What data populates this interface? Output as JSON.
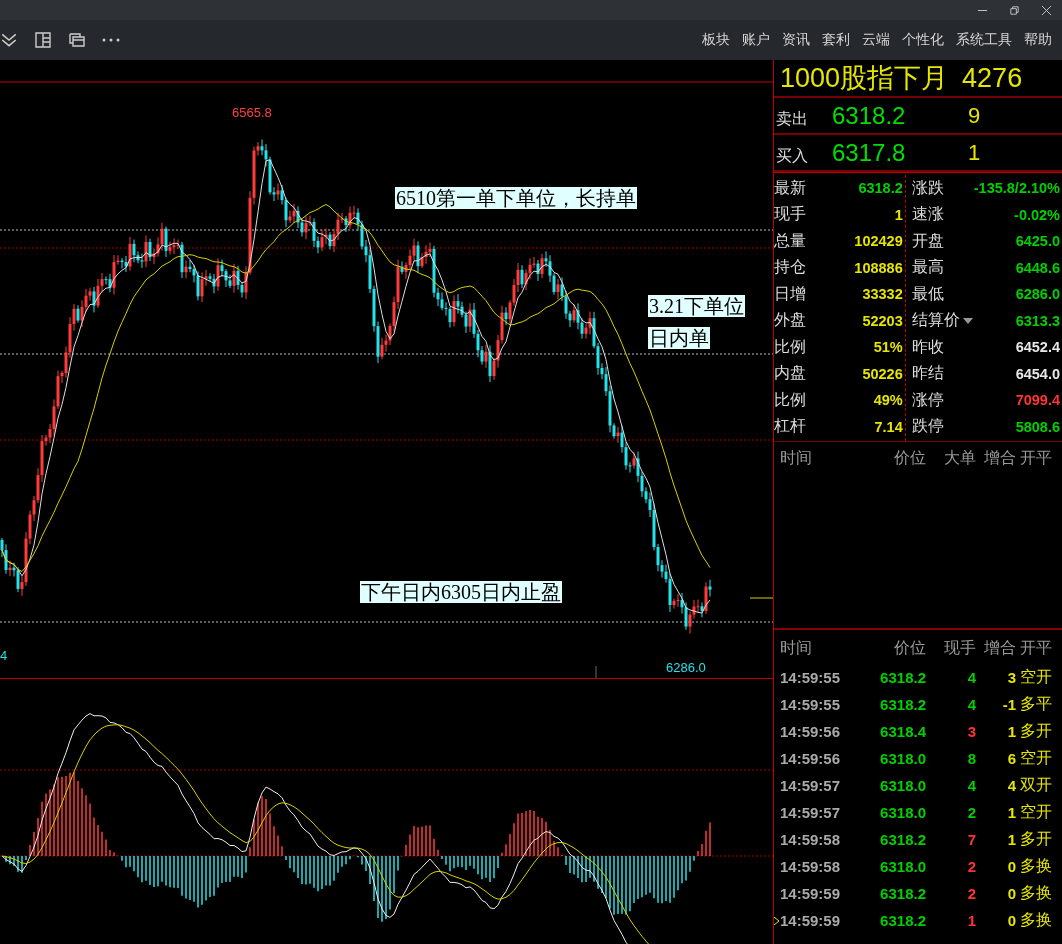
{
  "menu": [
    "板块",
    "账户",
    "资讯",
    "套利",
    "云端",
    "个性化",
    "系统工具",
    "帮助"
  ],
  "chart": {
    "high_label": "6565.8",
    "low_label": "6286.0",
    "edge_label": "4",
    "annotations": [
      {
        "lines": [
          "6510第一单下单位，长持单"
        ]
      },
      {
        "lines": [
          "3.21下单位",
          "日内单"
        ]
      },
      {
        "lines": [
          "下午日内6305日内止盈"
        ]
      }
    ]
  },
  "quote": {
    "title": "1000股指下月",
    "code": "4276",
    "sell": {
      "label": "卖出",
      "price": "6318.2",
      "volume": "9"
    },
    "buy": {
      "label": "买入",
      "price": "6317.8",
      "volume": "1"
    }
  },
  "stats": {
    "left": [
      {
        "label": "最新",
        "value": "6318.2",
        "color": "#00d000"
      },
      {
        "label": "现手",
        "value": "1",
        "color": "#e6e600"
      },
      {
        "label": "总量",
        "value": "102429",
        "color": "#e6e600"
      },
      {
        "label": "持仓",
        "value": "108886",
        "color": "#e6e600"
      },
      {
        "label": "日增",
        "value": "33332",
        "color": "#e6e600"
      },
      {
        "label": "外盘",
        "value": "52203",
        "color": "#e6e600"
      },
      {
        "label": "比例",
        "value": "51%",
        "color": "#e6e600"
      },
      {
        "label": "内盘",
        "value": "50226",
        "color": "#e6e600"
      },
      {
        "label": "比例",
        "value": "49%",
        "color": "#e6e600"
      },
      {
        "label": "杠杆",
        "value": "7.14",
        "color": "#e6e600"
      }
    ],
    "right": [
      {
        "label": "涨跌",
        "value": "-135.8/2.10%",
        "color": "#00d000",
        "dropdown": false
      },
      {
        "label": "速涨",
        "value": "-0.02%",
        "color": "#00d000",
        "dropdown": false
      },
      {
        "label": "开盘",
        "value": "6425.0",
        "color": "#00d000",
        "dropdown": false
      },
      {
        "label": "最高",
        "value": "6448.6",
        "color": "#00d000",
        "dropdown": false
      },
      {
        "label": "最低",
        "value": "6286.0",
        "color": "#00d000",
        "dropdown": false
      },
      {
        "label": "结算价",
        "value": "6313.3",
        "color": "#00d000",
        "dropdown": true
      },
      {
        "label": "昨收",
        "value": "6452.4",
        "color": "#e8e8e8",
        "dropdown": false
      },
      {
        "label": "昨结",
        "value": "6454.0",
        "color": "#e8e8e8",
        "dropdown": false
      },
      {
        "label": "涨停",
        "value": "7099.4",
        "color": "#ff3333",
        "dropdown": false
      },
      {
        "label": "跌停",
        "value": "5808.6",
        "color": "#00d000",
        "dropdown": false
      }
    ]
  },
  "big_orders": {
    "columns": [
      "时间",
      "价位",
      "大单",
      "增合",
      "开平"
    ]
  },
  "ticks": {
    "columns": [
      "时间",
      "价位",
      "现手",
      "增合",
      "开平"
    ],
    "rows": [
      {
        "time": "14:59:55",
        "price": "6318.2",
        "hand": "4",
        "change": "3",
        "type": "空开",
        "color": "#00d000",
        "selected": false
      },
      {
        "time": "14:59:55",
        "price": "6318.2",
        "hand": "4",
        "change": "-1",
        "type": "多平",
        "color": "#00d000",
        "selected": false
      },
      {
        "time": "14:59:56",
        "price": "6318.4",
        "hand": "3",
        "change": "1",
        "type": "多开",
        "color": "#ff3333",
        "selected": false
      },
      {
        "time": "14:59:56",
        "price": "6318.0",
        "hand": "8",
        "change": "6",
        "type": "空开",
        "color": "#00d000",
        "selected": false
      },
      {
        "time": "14:59:57",
        "price": "6318.0",
        "hand": "4",
        "change": "4",
        "type": "双开",
        "color": "#00d000",
        "selected": false
      },
      {
        "time": "14:59:57",
        "price": "6318.0",
        "hand": "2",
        "change": "1",
        "type": "空开",
        "color": "#00d000",
        "selected": false
      },
      {
        "time": "14:59:58",
        "price": "6318.2",
        "hand": "7",
        "change": "1",
        "type": "多开",
        "color": "#ff3333",
        "selected": false
      },
      {
        "time": "14:59:58",
        "price": "6318.0",
        "hand": "2",
        "change": "0",
        "type": "多换",
        "color": "#ff3333",
        "selected": false
      },
      {
        "time": "14:59:59",
        "price": "6318.2",
        "hand": "2",
        "change": "0",
        "type": "多换",
        "color": "#ff3333",
        "selected": false
      },
      {
        "time": "14:59:59",
        "price": "6318.2",
        "hand": "1",
        "change": "0",
        "type": "多换",
        "color": "#ff3333",
        "selected": true
      }
    ]
  }
}
